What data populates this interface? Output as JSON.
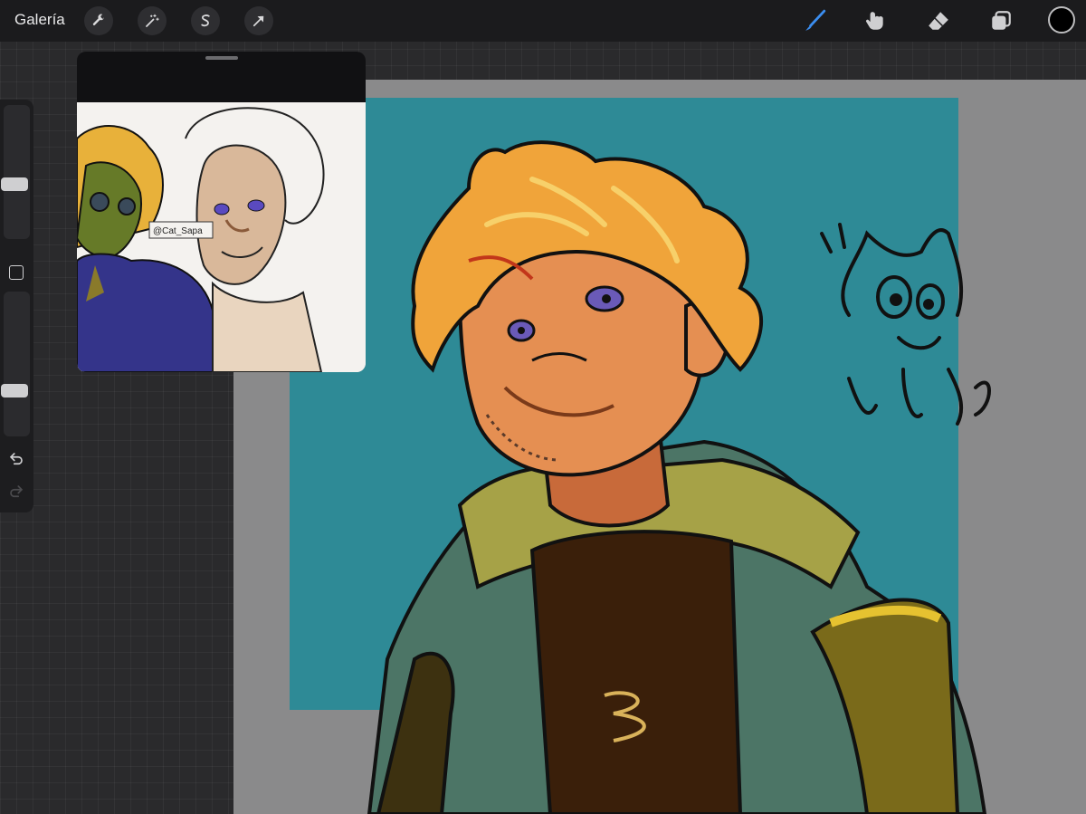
{
  "topbar": {
    "gallery_label": "Galería",
    "left_tools": [
      "wrench-icon",
      "magic-wand-icon",
      "selection-icon",
      "transform-arrow-icon"
    ],
    "right_tools": [
      "brush-icon",
      "smudge-icon",
      "eraser-icon",
      "layers-icon"
    ],
    "active_tool": "brush-icon",
    "accent_color": "#3b8ef0",
    "current_color": "#000000"
  },
  "sidebar": {
    "brush_size_level": 0.4,
    "opacity_level": 0.3,
    "tools": [
      "modify-button",
      "undo-icon",
      "redo-icon"
    ]
  },
  "reference": {
    "watermark_text": "@Cat_Sapa"
  },
  "canvas": {
    "background_color": "#2e8a96",
    "outside_color": "#8a8a8b"
  }
}
